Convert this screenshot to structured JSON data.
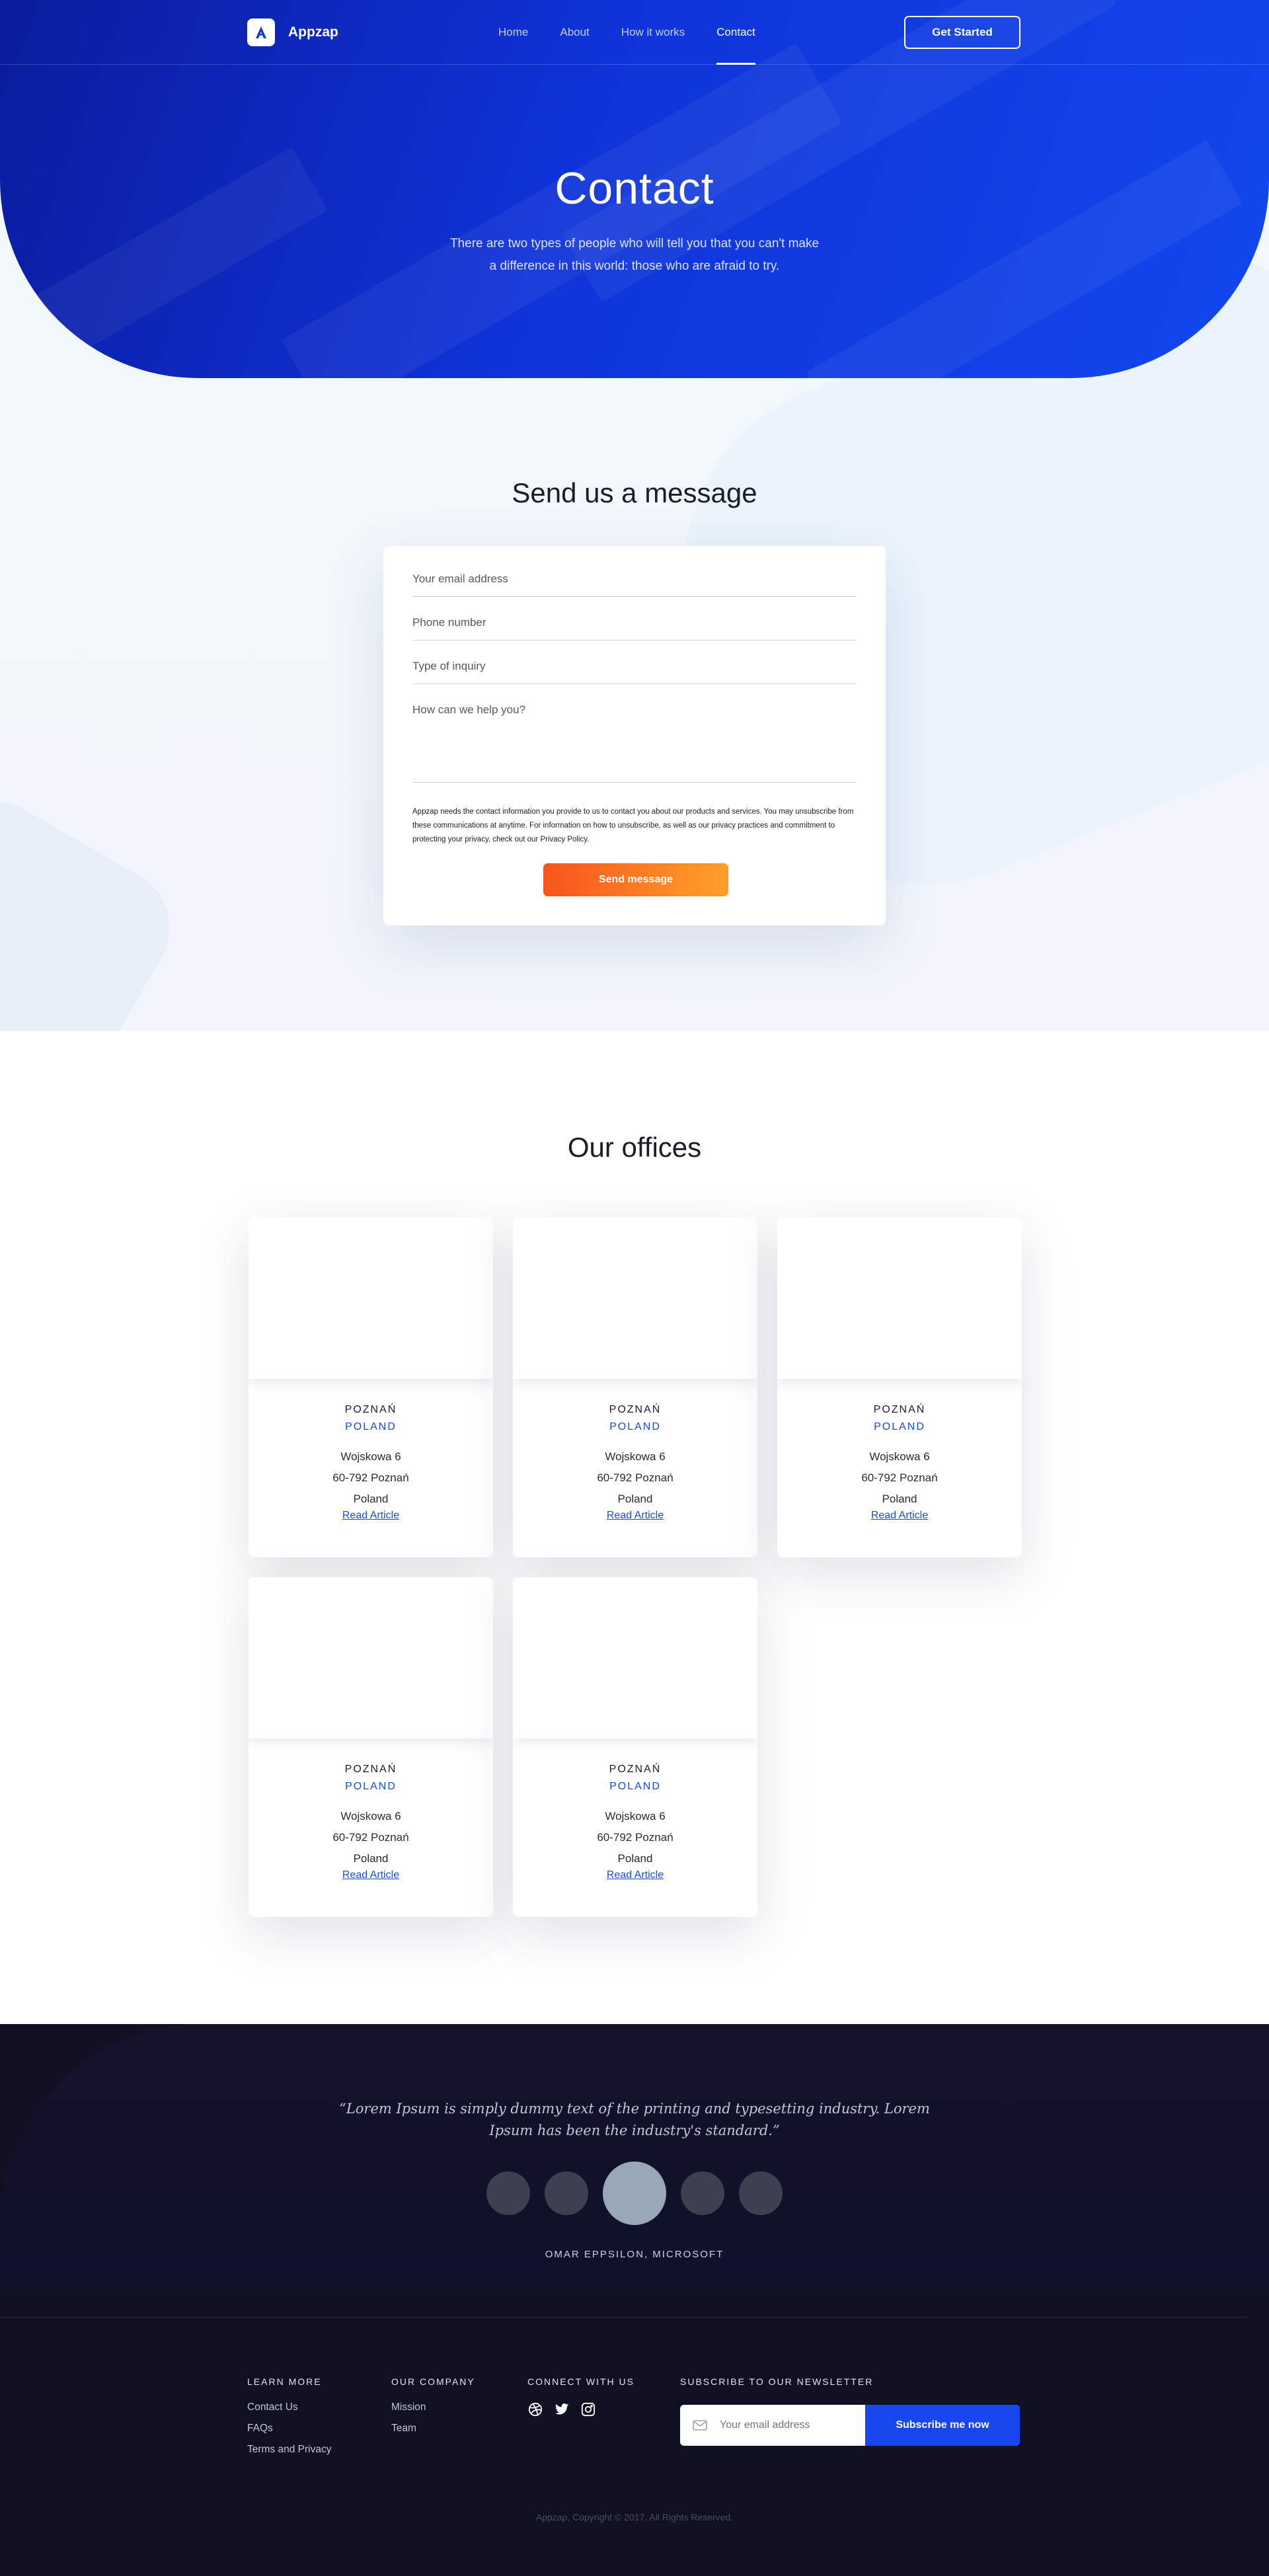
{
  "brand": {
    "name": "Appzap"
  },
  "nav": {
    "links": [
      "Home",
      "About",
      "How it works",
      "Contact"
    ],
    "active": "Contact",
    "cta_label": "Get Started"
  },
  "hero": {
    "title": "Contact",
    "subtitle": "There are two types of people who will tell you that you can't make a difference in this world: those who are afraid to try."
  },
  "contact_form": {
    "title": "Send us a message",
    "email_placeholder": "Your email address",
    "phone_placeholder": "Phone number",
    "inquiry_placeholder": "Type of inquiry",
    "message_placeholder": "How can we help you?",
    "consent_text": "Appzap needs the contact information you provide to us to contact you about our products and services. You may unsubscribe from these communications at anytime. For information on how to unsubscribe, as well as our privacy practices and commitment to protecting your privacy, check out our Privacy Policy.",
    "submit_label": "Send message"
  },
  "offices": {
    "title": "Our offices",
    "items": [
      {
        "city": "POZNAŃ",
        "country": "POLAND",
        "street": "Wojskowa 6",
        "postal": "60-792 Poznań",
        "land": "Poland",
        "link": "Read Article"
      },
      {
        "city": "POZNAŃ",
        "country": "POLAND",
        "street": "Wojskowa 6",
        "postal": "60-792 Poznań",
        "land": "Poland",
        "link": "Read Article"
      },
      {
        "city": "POZNAŃ",
        "country": "POLAND",
        "street": "Wojskowa 6",
        "postal": "60-792 Poznań",
        "land": "Poland",
        "link": "Read Article"
      },
      {
        "city": "POZNAŃ",
        "country": "POLAND",
        "street": "Wojskowa 6",
        "postal": "60-792 Poznań",
        "land": "Poland",
        "link": "Read Article"
      },
      {
        "city": "POZNAŃ",
        "country": "POLAND",
        "street": "Wojskowa 6",
        "postal": "60-792 Poznań",
        "land": "Poland",
        "link": "Read Article"
      }
    ]
  },
  "testimonial": {
    "quote": "“Lorem Ipsum is simply dummy text of the printing and typesetting industry. Lorem Ipsum has been the industry's standard.”",
    "author": "OMAR EPPSILON, MICROSOFT"
  },
  "footer": {
    "learn_more": {
      "title": "LEARN MORE",
      "links": [
        "Contact Us",
        "FAQs",
        "Terms and Privacy"
      ]
    },
    "company": {
      "title": "OUR COMPANY",
      "links": [
        "Mission",
        "Team"
      ]
    },
    "connect": {
      "title": "CONNECT WITH US",
      "icons": [
        "dribbble-icon",
        "twitter-icon",
        "instagram-icon"
      ]
    },
    "newsletter": {
      "title": "SUBSCRIBE TO OUR NEWSLETTER",
      "placeholder": "Your email address",
      "button": "Subscribe me now"
    },
    "copyright": "Appzap, Copyright © 2017. All Rights Reserved."
  },
  "colors": {
    "primary": "#1646ee",
    "hero_dark": "#0a1c9e",
    "accent_orange": "#f7541b",
    "footer_bg": "#0f1122"
  }
}
